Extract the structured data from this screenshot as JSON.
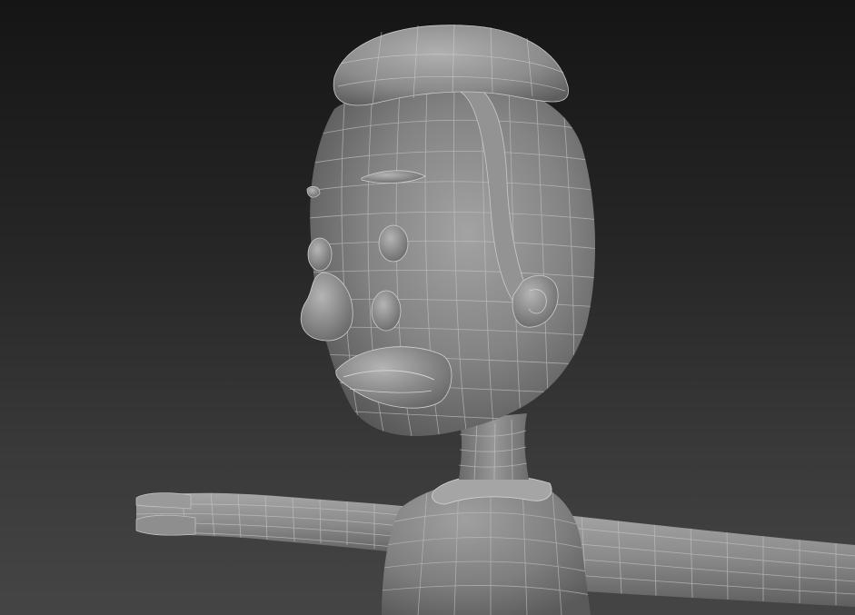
{
  "scene": {
    "subject": "",
    "colors": {
      "background_top": "#151515",
      "background_bottom": "#454545",
      "mesh_shade": "#7e7e7e",
      "wire": "#b9b9b9"
    }
  }
}
